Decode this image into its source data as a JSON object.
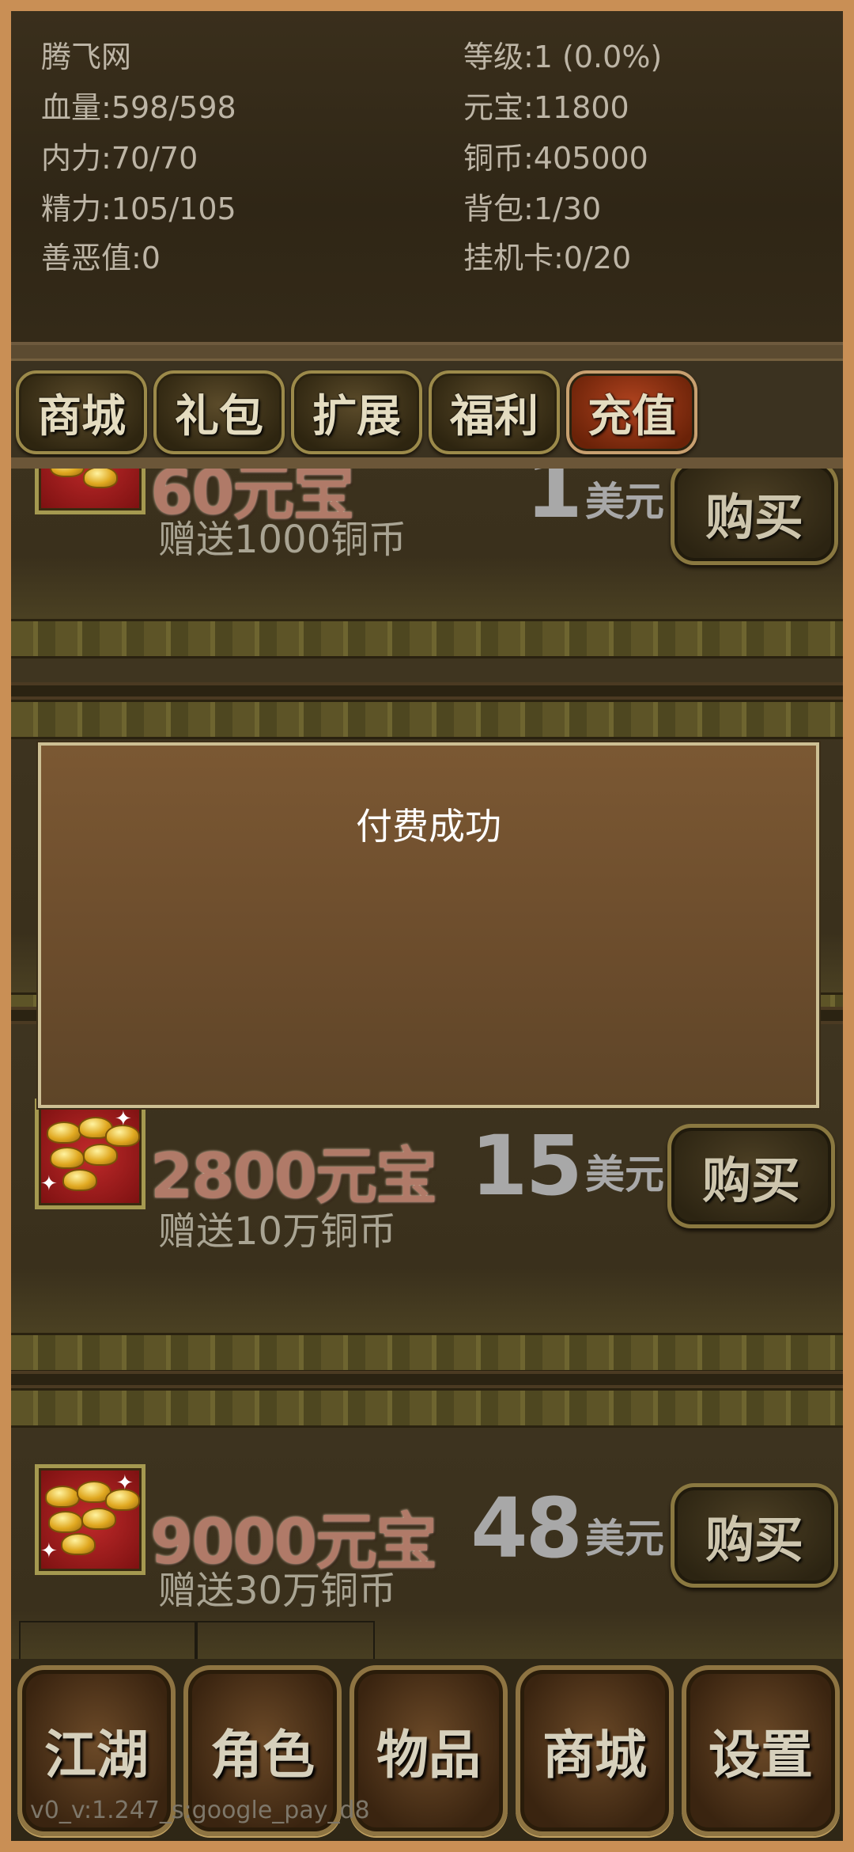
{
  "stats": {
    "name": "腾飞网",
    "level": "等级:1 (0.0%)",
    "hp": "血量:598/598",
    "yuanbao": "元宝:11800",
    "mp": "内力:70/70",
    "coins": "铜币:405000",
    "stamina": "精力:105/105",
    "bag": "背包:1/30",
    "karma": "善恶值:0",
    "idle_card": "挂机卡:0/20"
  },
  "tabs": [
    {
      "label": "商城"
    },
    {
      "label": "礼包"
    },
    {
      "label": "扩展"
    },
    {
      "label": "福利"
    },
    {
      "label": "充值",
      "active": true
    }
  ],
  "items": [
    {
      "amount": "60元宝",
      "bonus": "赠送1000铜币",
      "price": "1",
      "currency": "美元",
      "buy": "购买"
    },
    {
      "amount": "2800元宝",
      "bonus": "赠送10万铜币",
      "price": "15",
      "currency": "美元",
      "buy": "购买"
    },
    {
      "amount": "9000元宝",
      "bonus": "赠送30万铜币",
      "price": "48",
      "currency": "美元",
      "buy": "购买"
    }
  ],
  "modal": {
    "message": "付费成功"
  },
  "nav": [
    {
      "label": "江湖"
    },
    {
      "label": "角色"
    },
    {
      "label": "物品"
    },
    {
      "label": "商城"
    },
    {
      "label": "设置"
    }
  ],
  "version": "v0_v:1.247_s:google_pay_d8",
  "colors": {
    "frame": "#c98f55",
    "active_tab": "#9a3a18",
    "modal_bg": "#6b4c2c"
  }
}
